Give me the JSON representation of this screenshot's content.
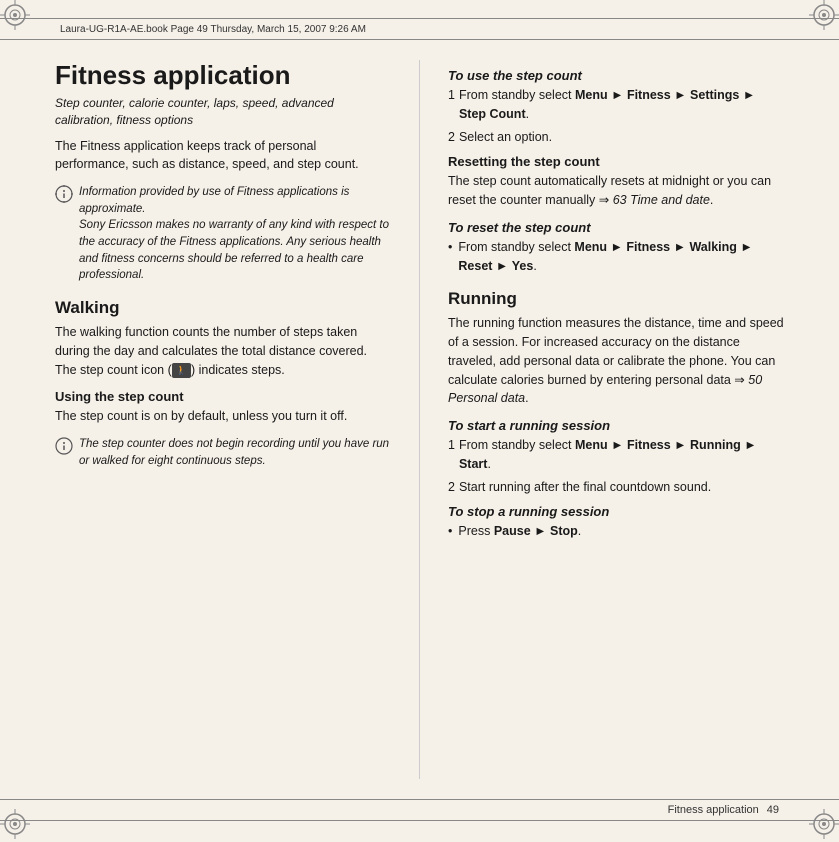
{
  "header": {
    "text": "Laura-UG-R1A-AE.book  Page 49  Thursday, March 15, 2007  9:26 AM"
  },
  "footer": {
    "section": "Fitness application",
    "page": "49"
  },
  "left_column": {
    "page_title": "Fitness application",
    "subtitle": "Step counter, calorie counter, laps, speed, advanced calibration, fitness options",
    "intro": "The Fitness application keeps track of personal performance, such as distance, speed, and step count.",
    "info_box1": {
      "icon": "info",
      "text": "Information provided by use of Fitness applications is approximate.\nSony Ericsson makes no warranty of any kind with respect to the accuracy of the Fitness applications. Any serious health and fitness concerns should be referred to a health care professional."
    },
    "walking_title": "Walking",
    "walking_body": "The walking function counts the number of steps taken during the day and calculates the total distance covered. The step count icon (🚶) indicates steps.",
    "using_step_count_title": "Using the step count",
    "using_step_count_body": "The step count is on by default, unless you turn it off.",
    "info_box2": {
      "icon": "info",
      "text": "The step counter does not begin recording until you have run or walked for eight continuous steps."
    }
  },
  "right_column": {
    "to_use_step_count_title": "To use the step count",
    "step1_label": "1",
    "step1_text": "From standby select ",
    "step1_menu": "Menu",
    "step1_arrow1": " ► ",
    "step1_fitness": "Fitness",
    "step1_arrow2": " ► ",
    "step1_settings": "Settings",
    "step1_arrow3": " ► ",
    "step1_step_count": "Step Count",
    "step1_period": ".",
    "step2_label": "2",
    "step2_text": "Select an option.",
    "resetting_title": "Resetting the step count",
    "resetting_body_pre": "The step count automatically resets at midnight or you can reset the counter manually ",
    "resetting_arrow": "⇒",
    "resetting_ref": "63 Time and date",
    "resetting_period": ".",
    "to_reset_title": "To reset the step count",
    "reset_bullet_pre": "From standby select ",
    "reset_menu": "Menu",
    "reset_arrow1": " ► ",
    "reset_fitness": "Fitness",
    "reset_arrow2": " ► ",
    "reset_walking": "Walking",
    "reset_arrow3": " ► ",
    "reset_reset": "Reset",
    "reset_arrow4": " ► ",
    "reset_yes": "Yes",
    "reset_period": ".",
    "running_title": "Running",
    "running_body": "The running function measures the distance, time and speed of a session. For increased accuracy on the distance traveled, add personal data or calibrate the phone. You can calculate calories burned by entering personal data ",
    "running_arrow": "⇒",
    "running_ref": "50 Personal data",
    "running_period": ".",
    "to_start_title": "To start a running session",
    "start_step1_label": "1",
    "start_step1_pre": "From standby select ",
    "start_step1_menu": "Menu",
    "start_step1_arrow1": " ► ",
    "start_step1_fitness": "Fitness",
    "start_step1_arrow2": " ► ",
    "start_step1_running": "Running",
    "start_step1_arrow3": " ► ",
    "start_step1_start": "Start",
    "start_step1_period": ".",
    "start_step2_label": "2",
    "start_step2_text": "Start running after the final countdown sound.",
    "to_stop_title": "To stop a running session",
    "stop_bullet_pre": "Press ",
    "stop_pause": "Pause",
    "stop_arrow": " ► ",
    "stop_stop": "Stop",
    "stop_period": "."
  }
}
